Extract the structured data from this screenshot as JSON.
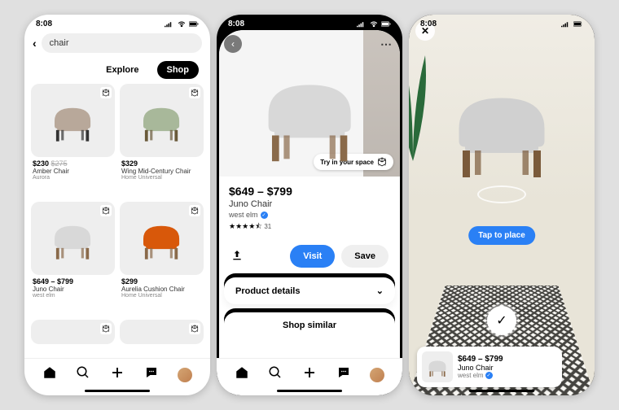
{
  "status": {
    "time": "8:08"
  },
  "search": {
    "query": "chair"
  },
  "tabs": {
    "explore": "Explore",
    "shop": "Shop"
  },
  "products": [
    {
      "price": "$230",
      "old_price": "$275",
      "name": "Amber Chair",
      "brand": "Aurora",
      "color": "#b8a89a",
      "accent": "#d9b84a"
    },
    {
      "price": "$329",
      "old_price": "",
      "name": "Wing Mid-Century Chair",
      "brand": "Home Universal",
      "color": "#a8b89a",
      "accent": "#8a9a7a"
    },
    {
      "price": "$649 – $799",
      "old_price": "",
      "name": "Juno Chair",
      "brand": "west elm",
      "color": "#d8d8d8",
      "accent": "#8a6a4a"
    },
    {
      "price": "$299",
      "old_price": "",
      "name": "Aurelia Cushion Chair",
      "brand": "Home Universal",
      "color": "#d8580a",
      "accent": "#8a6a4a"
    }
  ],
  "pdp": {
    "price": "$649 – $799",
    "title": "Juno Chair",
    "brand": "west elm",
    "rating_stars": "★★★★⯪",
    "rating_count": "31",
    "try_label": "Try in your space",
    "visit": "Visit",
    "save": "Save",
    "details": "Product details",
    "similar": "Shop similar"
  },
  "ar": {
    "tap": "Tap to place",
    "price": "$649 – $799",
    "name": "Juno Chair",
    "brand": "west elm"
  }
}
